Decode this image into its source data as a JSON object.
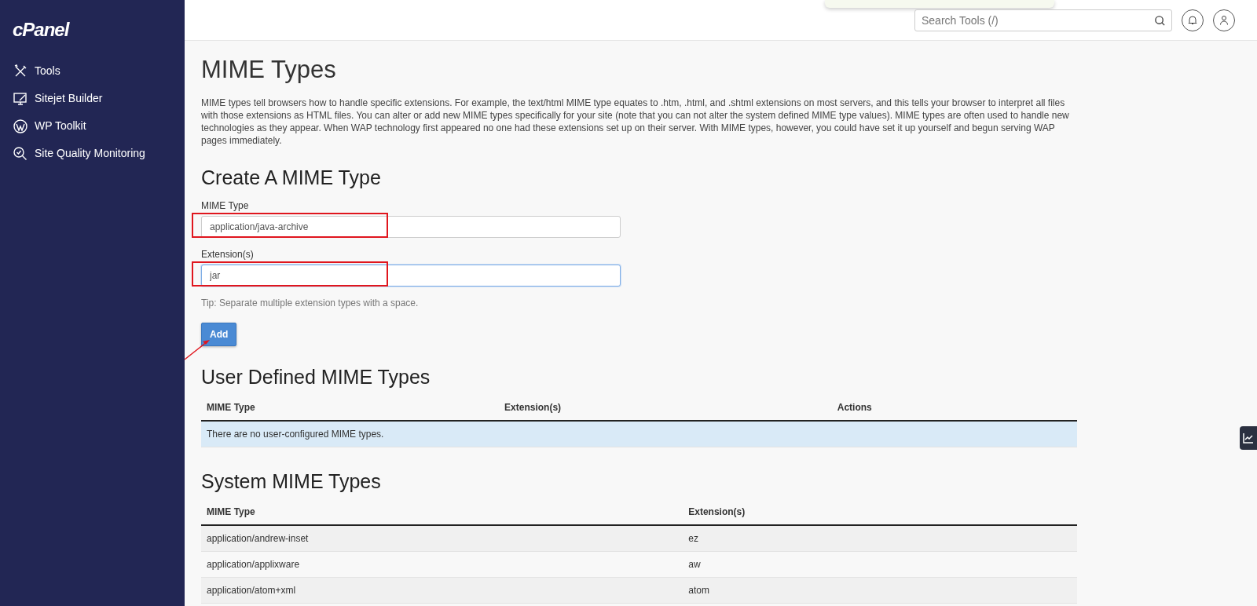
{
  "sidebar": {
    "logo": "cPanel",
    "items": [
      {
        "label": "Tools"
      },
      {
        "label": "Sitejet Builder"
      },
      {
        "label": "WP Toolkit"
      },
      {
        "label": "Site Quality Monitoring"
      }
    ]
  },
  "header": {
    "search": {
      "placeholder": "Search Tools (/)"
    }
  },
  "page": {
    "title": "MIME Types",
    "description": "MIME types tell browsers how to handle specific extensions. For example, the text/html MIME type equates to .htm, .html, and .shtml extensions on most servers, and this tells your browser to interpret all files with those extensions as HTML files. You can alter or add new MIME types specifically for your site (note that you can not alter the system defined MIME type values). MIME types are often used to handle new technologies as they appear. When WAP technology first appeared no one had these extensions set up on their server. With MIME types, however, you could have set it up yourself and begun serving WAP pages immediately."
  },
  "create_form": {
    "title": "Create A MIME Type",
    "fields": [
      {
        "label": "MIME Type",
        "value": "application/java-archive",
        "focused": false,
        "highlighted": true
      },
      {
        "label": "Extension(s)",
        "value": "jar",
        "focused": true,
        "highlighted": true,
        "hint": "Tip: Separate multiple extension types with a space."
      }
    ],
    "button": {
      "label": "Add",
      "pointed": true
    }
  },
  "user_table": {
    "title": "User Defined MIME Types",
    "columns": [
      "MIME Type",
      "Extension(s)",
      "Actions"
    ],
    "empty_message": "There are no user-configured MIME types."
  },
  "system_table": {
    "title": "System MIME Types",
    "columns": [
      "MIME Type",
      "Extension(s)"
    ],
    "rows": [
      [
        "application/andrew-inset",
        "ez"
      ],
      [
        "application/applixware",
        "aw"
      ],
      [
        "application/atom+xml",
        "atom"
      ]
    ]
  }
}
